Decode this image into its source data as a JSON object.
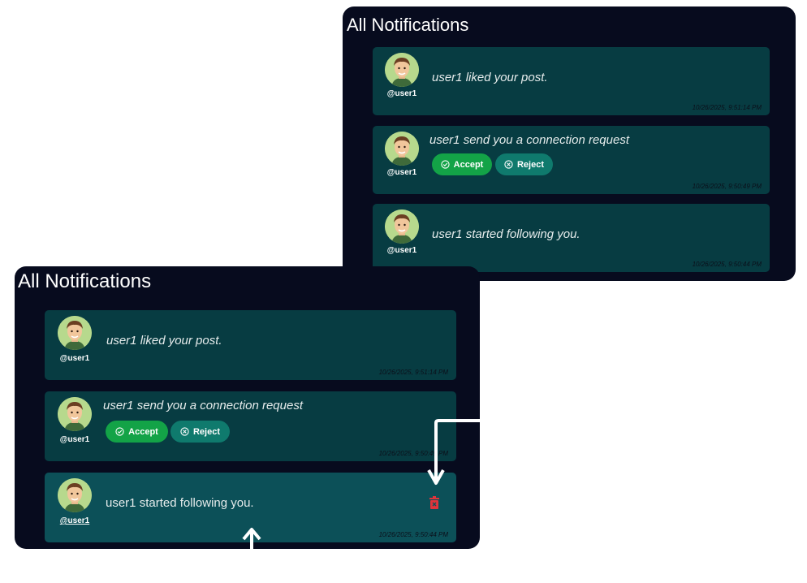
{
  "screens": [
    {
      "title": "All Notifications",
      "notifications": [
        {
          "user": "@user1",
          "message": "user1 liked your post.",
          "timestamp": "10/26/2025, 9:51:14 PM"
        },
        {
          "user": "@user1",
          "message": "user1 send you a connection request",
          "timestamp": "10/26/2025, 9:50:49 PM",
          "accept_label": "Accept",
          "reject_label": "Reject"
        },
        {
          "user": "@user1",
          "message": "user1 started following you.",
          "timestamp": "10/26/2025, 9:50:44 PM"
        }
      ]
    },
    {
      "title": "All Notifications",
      "notifications": [
        {
          "user": "@user1",
          "message": "user1 liked your post.",
          "timestamp": "10/26/2025, 9:51:14 PM"
        },
        {
          "user": "@user1",
          "message": "user1 send you a connection request",
          "timestamp": "10/26/2025, 9:50:49 PM",
          "accept_label": "Accept",
          "reject_label": "Reject"
        },
        {
          "user": "@user1",
          "message": "user1 started following you.",
          "timestamp": "10/26/2025, 9:50:44 PM",
          "hovered": true,
          "delete_icon": "trash-icon"
        }
      ]
    }
  ],
  "colors": {
    "panel_bg": "#070b1e",
    "card_bg": "#073c42",
    "card_hover_bg": "#0c5058",
    "accept": "#13a347",
    "reject": "#0f7a6d",
    "delete": "#e0343b"
  }
}
